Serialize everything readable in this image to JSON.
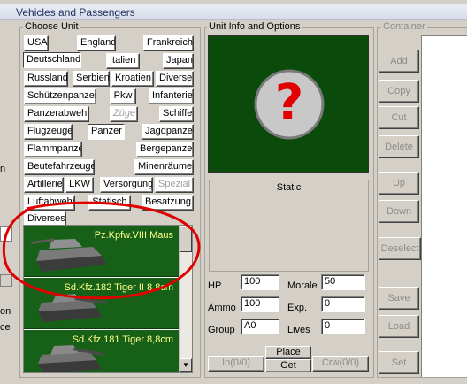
{
  "window": {
    "title": "Vehicles and Passengers"
  },
  "left_edge": {
    "text_n": "n",
    "text_on": "on",
    "text_ce": "ce"
  },
  "choose_unit": {
    "label": "Choose Unit",
    "buttons": {
      "usa": "USA",
      "england": "England",
      "frankreich": "Frankreich",
      "deutschland": "Deutschland",
      "italien": "Italien",
      "japan": "Japan",
      "russland": "Russland",
      "serbien": "Serbien",
      "kroatien": "Kroatien",
      "diverse": "Diverse",
      "schuetzenpanzer": "Schützenpanzer",
      "pkw": "Pkw",
      "infanterie": "Infanterie",
      "panzerabwehr": "Panzerabwehr",
      "zuege": "Züge",
      "schiffe": "Schiffe",
      "flugzeuge": "Flugzeuge",
      "panzer": "Panzer",
      "jagdpanzer": "Jagdpanzer",
      "flammpanzer": "Flammpanzer",
      "bergepanzer": "Bergepanzer",
      "beutefahrzeuge": "Beutefahrzeuge",
      "minenraeumer": "Minenräumer",
      "artillerie": "Artillerie",
      "lkw": "LKW",
      "versorgung": "Versorgung",
      "spezial": "Spezial",
      "luftabwehr": "Luftabwehr",
      "statisch": "Statisch",
      "besatzung": "Besatzung",
      "diverses": "Diverses"
    },
    "units": [
      {
        "name": "Pz.Kpfw.VIII Maus"
      },
      {
        "name": "Sd.Kfz.182 Tiger II 8,8cm"
      },
      {
        "name": "Sd.Kfz.181 Tiger 8,8cm"
      }
    ],
    "scroll_down_glyph": "▼"
  },
  "unit_info": {
    "label": "Unit Info and Options",
    "preview_symbol": "?",
    "type_text": "Static",
    "stats": {
      "hp_label": "HP",
      "hp": "100",
      "morale_label": "Morale",
      "morale": "50",
      "ammo_label": "Ammo",
      "ammo": "100",
      "exp_label": "Exp.",
      "exp": "0",
      "group_label": "Group",
      "group": "A0",
      "lives_label": "Lives",
      "lives": "0"
    },
    "buttons": {
      "in": "In(0/0)",
      "place": "Place",
      "get": "Get",
      "crw": "Crw(0/0)"
    }
  },
  "container": {
    "label": "Container",
    "buttons": {
      "add": "Add",
      "copy": "Copy",
      "cut": "Cut",
      "delete": "Delete",
      "up": "Up",
      "down": "Down",
      "deselect": "Deselect",
      "save": "Save",
      "load": "Load",
      "set": "Set"
    }
  },
  "colors": {
    "unit_list_bg": "#176017",
    "unit_name": "#ffff8a",
    "preview_bg": "#0a4a0a",
    "highlight_circle": "#e00000"
  }
}
